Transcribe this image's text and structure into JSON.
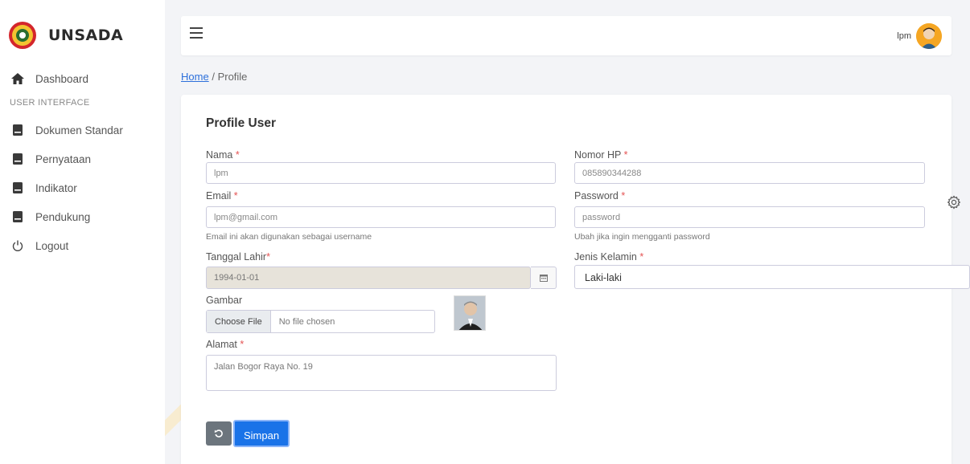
{
  "brand": {
    "name": "UNSADA"
  },
  "sidebar": {
    "dashboard": "Dashboard",
    "section_title": "USER INTERFACE",
    "items": [
      {
        "label": "Dokumen Standar",
        "icon": "book-icon"
      },
      {
        "label": "Pernyataan",
        "icon": "book-icon"
      },
      {
        "label": "Indikator",
        "icon": "book-icon"
      },
      {
        "label": "Pendukung",
        "icon": "book-icon"
      }
    ],
    "logout": "Logout"
  },
  "topbar": {
    "user_name": "lpm"
  },
  "breadcrumb": {
    "home": "Home",
    "separator": "/",
    "current": "Profile"
  },
  "form": {
    "title": "Profile User",
    "required_mark": "*",
    "nama": {
      "label": "Nama",
      "value": "lpm"
    },
    "nomor_hp": {
      "label": "Nomor HP",
      "value": "085890344288"
    },
    "email": {
      "label": "Email",
      "value": "lpm@gmail.com",
      "help": "Email ini akan digunakan sebagai username"
    },
    "password": {
      "label": "Password",
      "value": "password",
      "help": "Ubah jika ingin mengganti password"
    },
    "tanggal_lahir": {
      "label": "Tanggal Lahir",
      "value": "1994-01-01"
    },
    "jenis_kelamin": {
      "label": "Jenis Kelamin",
      "value": "Laki-laki"
    },
    "gambar": {
      "label": "Gambar",
      "button": "Choose File",
      "status": "No file chosen"
    },
    "alamat": {
      "label": "Alamat",
      "value": "Jalan Bogor Raya No. 19"
    },
    "save_label": "Simpan"
  },
  "colors": {
    "accent": "#1a73e8",
    "required": "#e55353",
    "reset_button": "#6c757d"
  }
}
